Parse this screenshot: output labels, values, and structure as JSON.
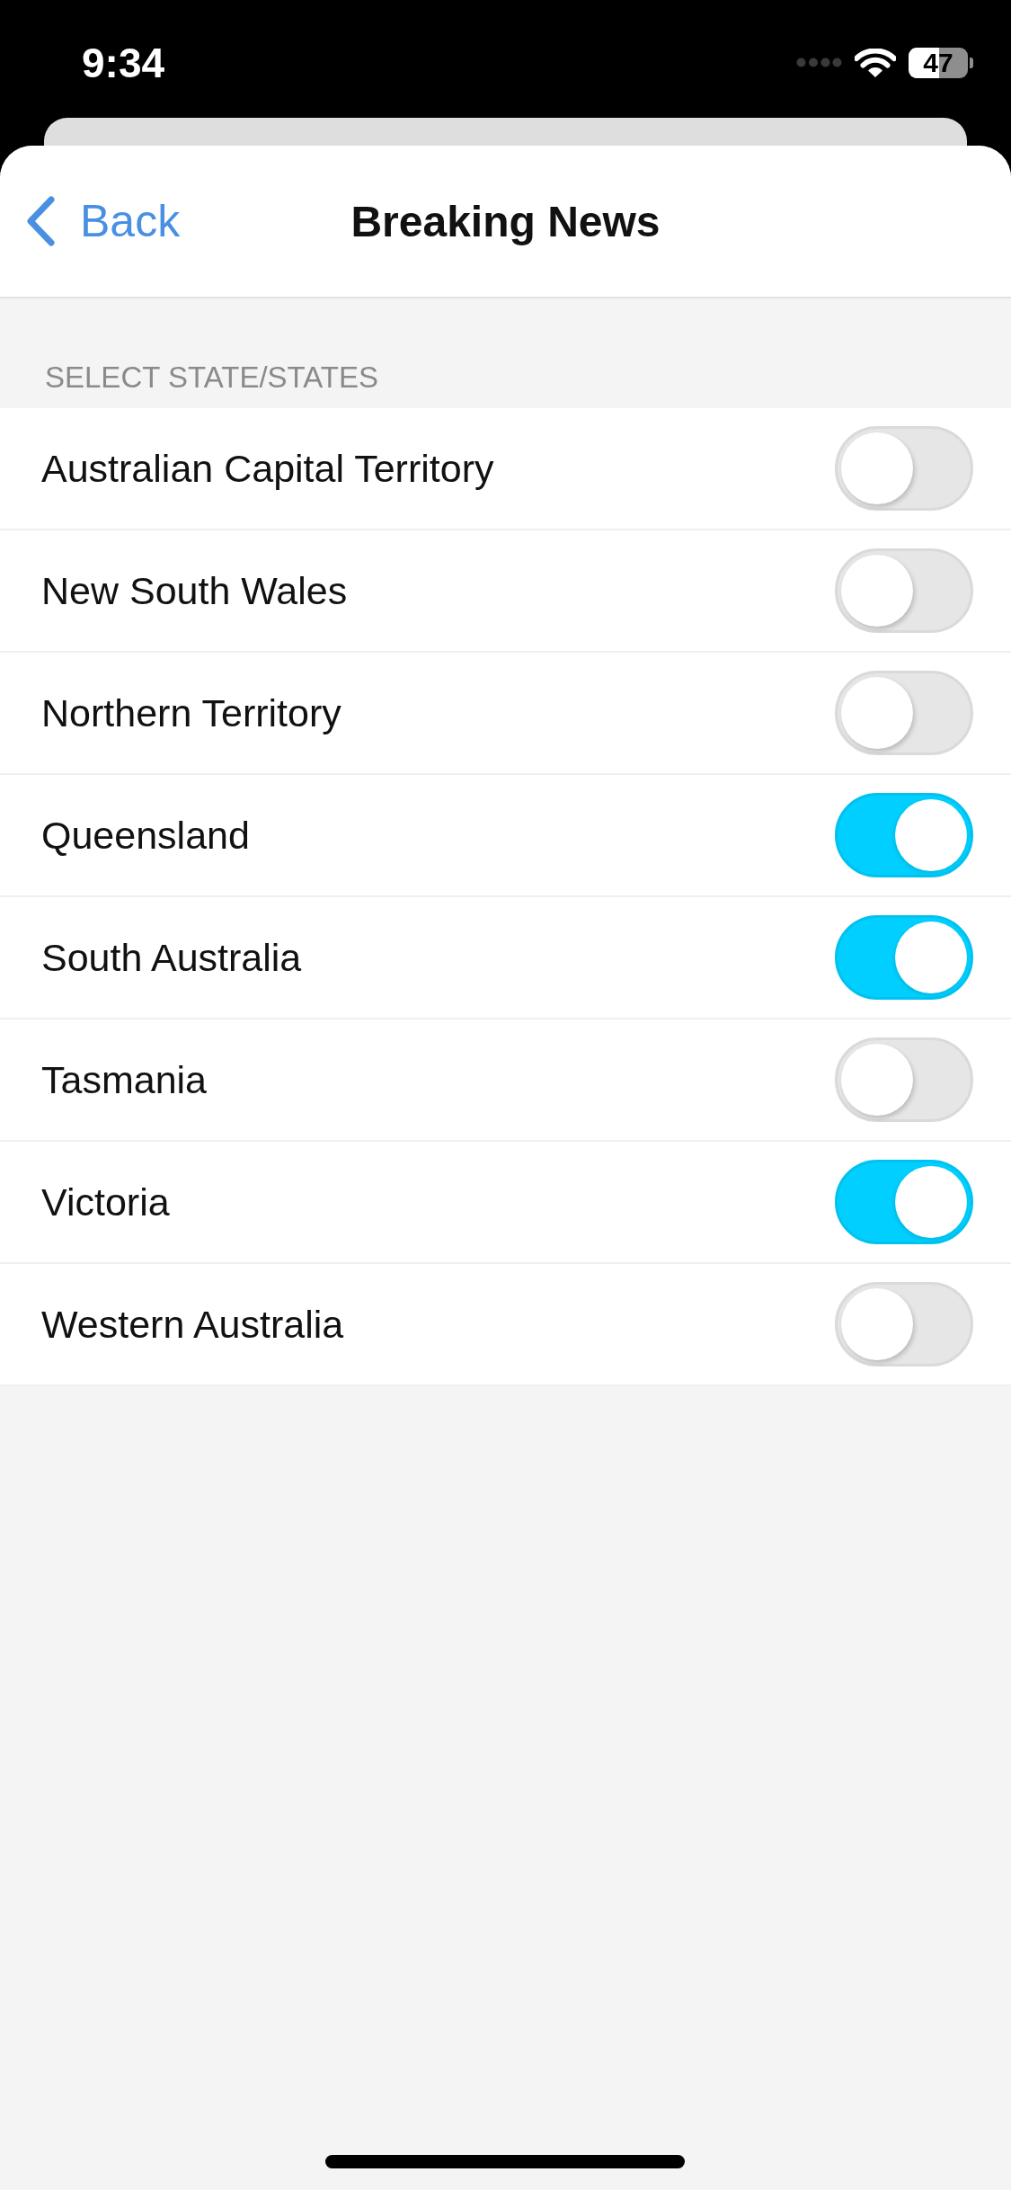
{
  "status_bar": {
    "time": "9:34",
    "battery": "47"
  },
  "nav_bar": {
    "back_label": "Back",
    "title": "Breaking News"
  },
  "section": {
    "header": "SELECT STATE/STATES",
    "items": [
      {
        "label": "Australian Capital Territory",
        "on": false
      },
      {
        "label": "New South Wales",
        "on": false
      },
      {
        "label": "Northern Territory",
        "on": false
      },
      {
        "label": "Queensland",
        "on": true
      },
      {
        "label": "South Australia",
        "on": true
      },
      {
        "label": "Tasmania",
        "on": false
      },
      {
        "label": "Victoria",
        "on": true
      },
      {
        "label": "Western Australia",
        "on": false
      }
    ]
  }
}
